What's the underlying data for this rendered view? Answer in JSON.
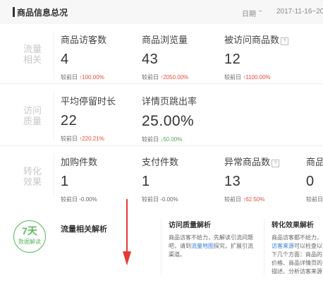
{
  "header": {
    "title": "商品信息总况",
    "date_label": "日期",
    "date_range": "2017-11-16~2017-"
  },
  "rows": [
    {
      "label": "流量\n相关",
      "metrics": [
        {
          "name": "商品访客数",
          "value": "4",
          "cmp_label": "较前日",
          "cmp_arrow": "↑",
          "cmp_value": "100.00%",
          "trend": "up"
        },
        {
          "name": "商品浏览量",
          "value": "43",
          "cmp_label": "较前日",
          "cmp_arrow": "↑",
          "cmp_value": "2050.00%",
          "trend": "up"
        },
        {
          "name": "被访问商品数",
          "value": "12",
          "cmp_label": "较前日",
          "cmp_arrow": "↑",
          "cmp_value": "1100.00%",
          "trend": "up"
        }
      ]
    },
    {
      "label": "访问\n质量",
      "metrics": [
        {
          "name": "平均停留时长",
          "value": "22",
          "cmp_label": "较前日",
          "cmp_arrow": "↑",
          "cmp_value": "220.21%",
          "trend": "up"
        },
        {
          "name": "详情页跳出率",
          "value": "25.00%",
          "cmp_label": "较前日",
          "cmp_arrow": "↓",
          "cmp_value": "50.00%",
          "trend": "down"
        }
      ]
    },
    {
      "label": "转化\n效果",
      "metrics": [
        {
          "name": "加购件数",
          "value": "1",
          "cmp_label": "较前日",
          "cmp_arrow": "-",
          "cmp_value": "0.00%",
          "trend": "flat"
        },
        {
          "name": "支付件数",
          "value": "1",
          "cmp_label": "较前日",
          "cmp_arrow": "-",
          "cmp_value": "0.00%",
          "trend": "flat"
        },
        {
          "name": "异常商品数",
          "value": "13",
          "cmp_label": "较前日",
          "cmp_arrow": "↑",
          "cmp_value": "62.50%",
          "trend": "up"
        },
        {
          "name": "商品",
          "value": "0",
          "cmp_label": "较前日",
          "cmp_arrow": "-",
          "cmp_value": "",
          "trend": "flat"
        }
      ]
    }
  ],
  "help_glyph": "?",
  "bottom": {
    "badge_num": "7天",
    "badge_sub": "数据解读",
    "flow_title": "流量相关解析",
    "cards": [
      {
        "title": "访问质量解析",
        "desc_pre": "商品访客不给力，先解读引流问题吧，请到",
        "desc_link": "流量地图",
        "desc_post": "探究，扩展引流渠道。"
      },
      {
        "title": "转化效果解析",
        "desc_pre": "商品访客都不给力，",
        "desc_link": "访客来源",
        "desc_post": "可以检查以下几个方面：商品的价格、商品详情页的描述、分析访客来源和流量属性。"
      }
    ]
  },
  "colors": {
    "up": "#e74c3c",
    "down": "#5aa35a",
    "accent_green": "#5fb85f",
    "arrow_red": "#e53935"
  },
  "annotation": {
    "arrow_icon": "down-arrow"
  }
}
